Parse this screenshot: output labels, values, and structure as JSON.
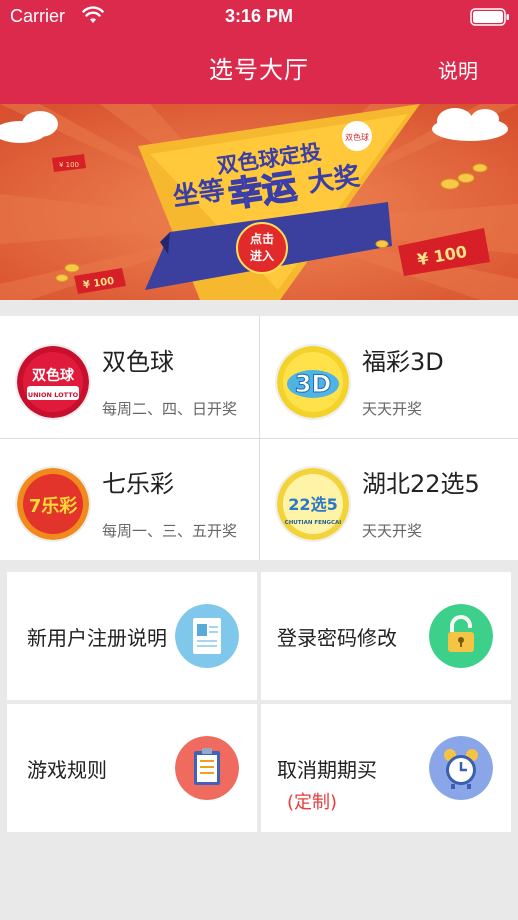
{
  "status_bar": {
    "carrier": "Carrier",
    "time": "3:16 PM"
  },
  "nav": {
    "title": "选号大厅",
    "help_label": "说明"
  },
  "banner": {
    "headline": "双色球定投",
    "main_text_1": "坐等",
    "main_text_2": "幸运",
    "main_text_3": "大奖",
    "button_text_1": "点击",
    "button_text_2": "进入",
    "coupon_big": "¥ 100",
    "coupon_small": "¥ 100",
    "coupon_tiny": "¥ 100",
    "logo_text": "双色球"
  },
  "lotteries": [
    {
      "name": "双色球",
      "schedule": "每周二、四、日开奖",
      "logo_text": "双色球",
      "logo_subtext": "UNION LOTTO"
    },
    {
      "name": "福彩3D",
      "schedule": "天天开奖",
      "logo_text": "3D"
    },
    {
      "name": "七乐彩",
      "schedule": "每周一、三、五开奖",
      "logo_text": "7乐彩"
    },
    {
      "name": "湖北22选5",
      "schedule": "天天开奖",
      "logo_text": "22选5",
      "logo_subtext": "CHUTIAN FENGCAI"
    }
  ],
  "actions": [
    {
      "label": "新用户注册说明",
      "icon": "register-doc-icon",
      "color": "#7fc8ec"
    },
    {
      "label": "登录密码修改",
      "icon": "lock-icon",
      "color": "#3dd08a"
    },
    {
      "label": "游戏规则",
      "icon": "clipboard-icon",
      "color": "#ef6b5f"
    },
    {
      "label": "取消期期买",
      "sublabel": "(定制)",
      "icon": "alarm-clock-icon",
      "color": "#8aa6e8"
    }
  ]
}
